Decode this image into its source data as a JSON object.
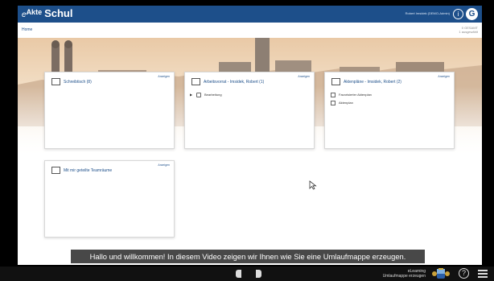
{
  "header": {
    "brand_e": "e",
    "brand_akte": "Akte",
    "brand_schul": "Schul",
    "user": "Robert Imsidek (DEMO-Admin)",
    "info_glyph": "i",
    "logo_glyph": "G"
  },
  "breadcrumb": {
    "home": "Home",
    "selection_line1": "0 GESAMT",
    "selection_line2": "1 ausgewählt"
  },
  "cards": {
    "schreibtisch": {
      "title": "Schreibtisch (8)",
      "link": "Anzeigen",
      "icon": "monitor-icon"
    },
    "arbeitsvorrat": {
      "title": "Arbeitsvorrat - Imsidek, Robert (1)",
      "link": "Anzeigen",
      "row1": "Bearbeitung",
      "icon": "list-icon"
    },
    "aktenplaene": {
      "title": "Aktenpläne - Imsidek, Robert (2)",
      "link": "Anzeigen",
      "row1": "Favorisierter Aktenplan",
      "row2": "Aktenplan",
      "icon": "folder-tree-icon"
    },
    "teamraeume": {
      "title": "Mit mir geteilte Teamräume",
      "link": "Anzeigen",
      "icon": "shared-folder-icon"
    }
  },
  "subtitle": "Hallo und willkommen! In diesem Video zeigen wir Ihnen wie Sie eine Umlaufmappe erzeugen.",
  "bottom": {
    "caption_line1": "eLearning",
    "caption_line2": "Umlaufmappe erzeugen",
    "help_glyph": "?"
  },
  "colors": {
    "header_bg": "#1d4f8a",
    "accent": "#1d4f8a",
    "card_border": "#d8d8d8"
  }
}
